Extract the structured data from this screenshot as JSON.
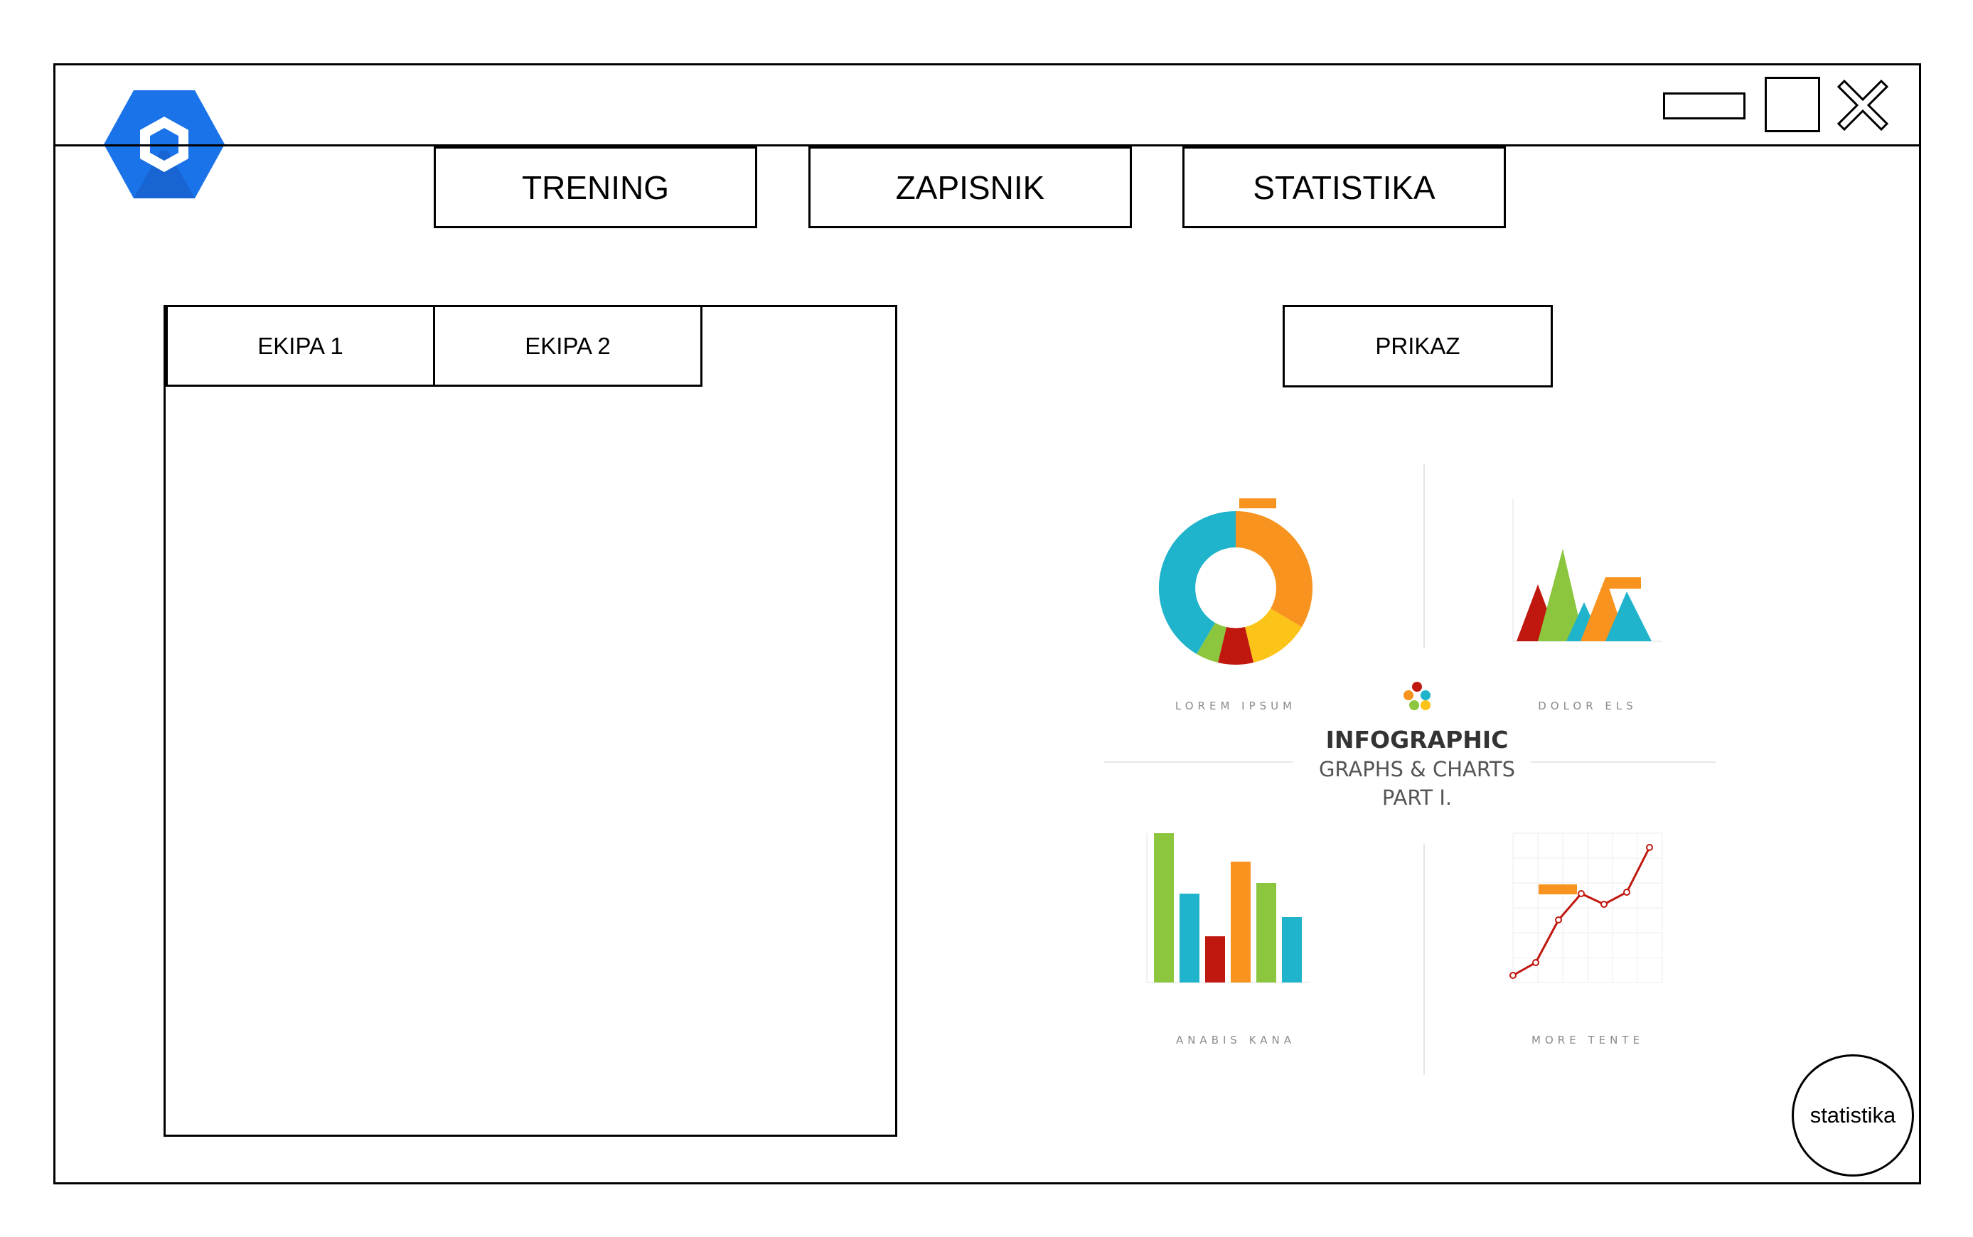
{
  "nav": {
    "tabs": [
      {
        "label": "TRENING"
      },
      {
        "label": "ZAPISNIK"
      },
      {
        "label": "STATISTIKA"
      }
    ]
  },
  "teams": {
    "tabs": [
      {
        "label": "EKIPA 1"
      },
      {
        "label": "EKIPA 2"
      }
    ]
  },
  "prikaz_label": "PRIKAZ",
  "infographic": {
    "labels": [
      "LOREM IPSUM",
      "DOLOR ELS",
      "ANABIS KANA",
      "MORE TENTE"
    ],
    "title": "INFOGRAPHIC",
    "subtitle": "GRAPHS & CHARTS",
    "part": "PART I."
  },
  "statistika_button": "statistika",
  "colors": {
    "logo": "#1a73e8",
    "teal": "#1fb4cc",
    "orange": "#f7931e",
    "yellow": "#fcc419",
    "red": "#c0170f",
    "green": "#8cc63f"
  },
  "icons": {
    "logo": "hexagon-logo-icon",
    "minimize": "minimize-icon",
    "maximize": "maximize-icon",
    "close": "close-icon"
  }
}
